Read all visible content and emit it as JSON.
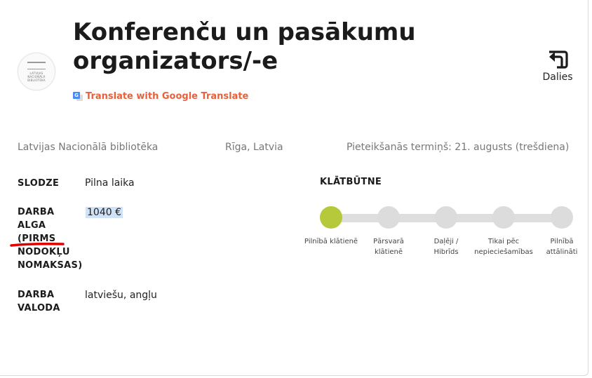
{
  "title": "Konferenču un pasākumu organizators/-e",
  "logo": {
    "text_line1": "LATVIJAS",
    "text_line2": "NACIONĀLĀ",
    "text_line3": "BIBLIOTĒKA"
  },
  "translate_label": "Translate with Google Translate",
  "share_label": "Dalies",
  "meta": {
    "organization": "Latvijas Nacionālā bibliotēka",
    "location": "Rīga, Latvia",
    "deadline": "Pieteikšanās termiņš: 21. augusts (trešdiena)"
  },
  "fields": {
    "workload": {
      "label": "SLODZE",
      "value": "Pilna laika"
    },
    "salary": {
      "label": "DARBA ALGA (PIRMS NODOKĻU NOMAKSAS)",
      "value": "1040 €"
    },
    "language": {
      "label": "DARBA VALODA",
      "value": "latviešu, angļu"
    }
  },
  "presence": {
    "title": "KLĀTBŪTNE",
    "active_index": 0,
    "options": [
      "Pilnībā klātienē",
      "Pārsvarā klātienē",
      "Daļēji / Hibrīds",
      "Tikai pēc nepieciešamības",
      "Pilnībā attālināti"
    ]
  },
  "colors": {
    "accent_active": "#b5c93a",
    "translate_link": "#e8603c",
    "annotation_red": "#e00000"
  }
}
